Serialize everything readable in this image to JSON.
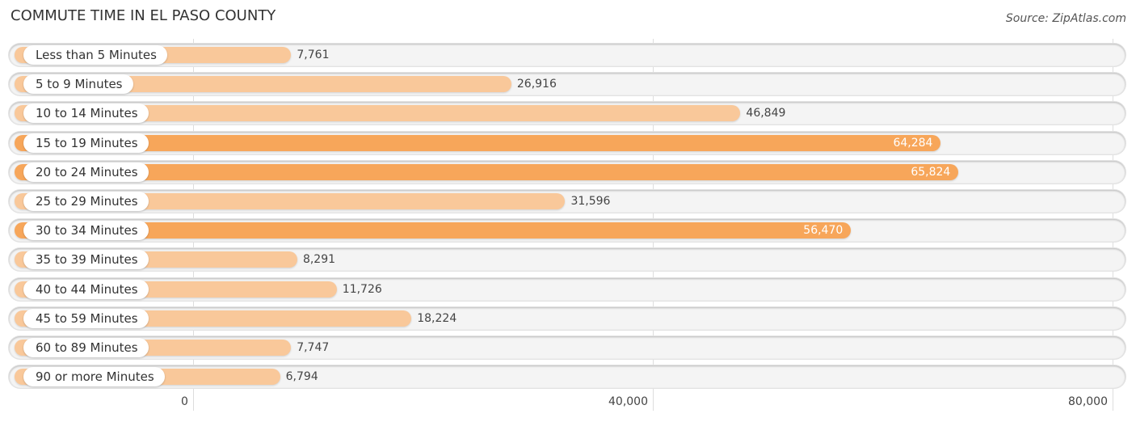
{
  "title": "COMMUTE TIME IN EL PASO COUNTY",
  "source": "Source: ZipAtlas.com",
  "colors": {
    "light_bar": "#f9c89a",
    "dark_bar": "#f7a65a",
    "track": "#f4f4f4"
  },
  "chart_data": {
    "type": "bar",
    "orientation": "horizontal",
    "title": "COMMUTE TIME IN EL PASO COUNTY",
    "xlabel": "",
    "ylabel": "",
    "xlim": [
      0,
      80000
    ],
    "grid": true,
    "categories": [
      "Less than 5 Minutes",
      "5 to 9 Minutes",
      "10 to 14 Minutes",
      "15 to 19 Minutes",
      "20 to 24 Minutes",
      "25 to 29 Minutes",
      "30 to 34 Minutes",
      "35 to 39 Minutes",
      "40 to 44 Minutes",
      "45 to 59 Minutes",
      "60 to 89 Minutes",
      "90 or more Minutes"
    ],
    "values": [
      7761,
      26916,
      46849,
      64284,
      65824,
      31596,
      56470,
      8291,
      11726,
      18224,
      7747,
      6794
    ],
    "value_labels": [
      "7,761",
      "26,916",
      "46,849",
      "64,284",
      "65,824",
      "31,596",
      "56,470",
      "8,291",
      "11,726",
      "18,224",
      "7,747",
      "6,794"
    ],
    "ticks": [
      0,
      40000,
      80000
    ],
    "tick_labels": [
      "0",
      "40,000",
      "80,000"
    ]
  }
}
